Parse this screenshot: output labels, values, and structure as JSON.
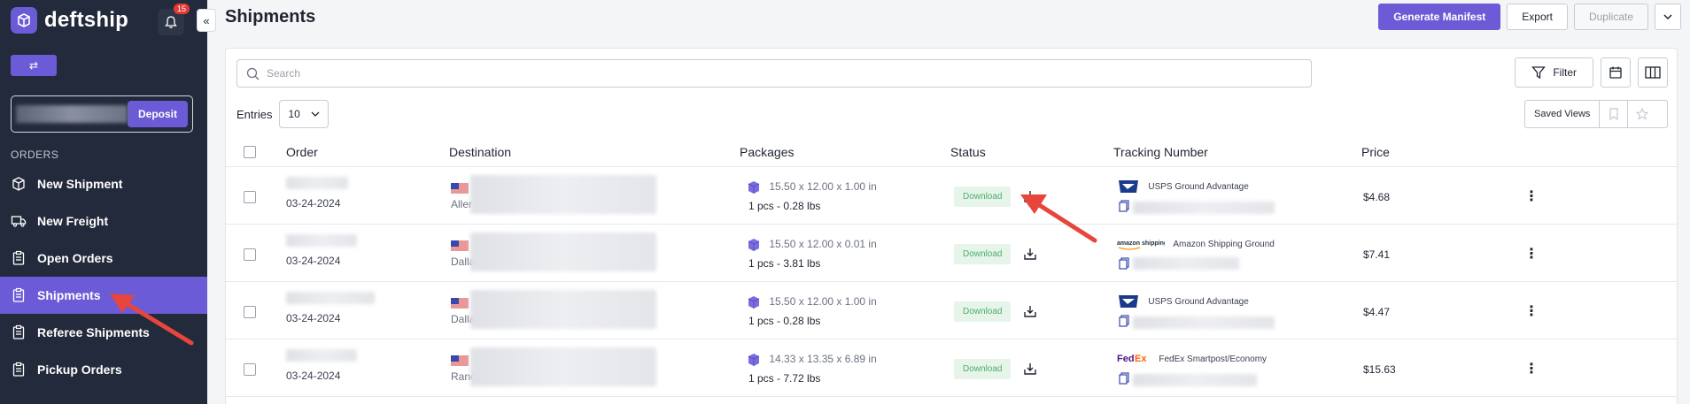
{
  "sidebar": {
    "brand": "deftship",
    "notifications_count": "15",
    "balance_button": "Deposit",
    "section_orders": "ORDERS",
    "items": [
      {
        "label": "New Shipment",
        "active": false
      },
      {
        "label": "New Freight",
        "active": false
      },
      {
        "label": "Open Orders",
        "active": false
      },
      {
        "label": "Shipments",
        "active": true
      },
      {
        "label": "Referee Shipments",
        "active": false
      },
      {
        "label": "Pickup Orders",
        "active": false
      }
    ]
  },
  "header": {
    "title": "Shipments",
    "generate_manifest": "Generate Manifest",
    "export": "Export",
    "duplicate": "Duplicate"
  },
  "toolbar": {
    "search_placeholder": "Search",
    "filter": "Filter",
    "entries_label": "Entries",
    "entries_value": "10",
    "saved_views": "Saved Views"
  },
  "table": {
    "columns": [
      "Order",
      "Destination",
      "Packages",
      "Status",
      "Tracking Number",
      "Price"
    ],
    "rows": [
      {
        "date": "03-24-2024",
        "city": "Aller",
        "dims": "15.50 x 12.00 x 1.00 in",
        "qty": "1 pcs - 0.28 lbs",
        "status": "Download",
        "carrier": "USPS Ground Advantage",
        "carrier_type": "usps",
        "price": "$4.68"
      },
      {
        "date": "03-24-2024",
        "city": "Dalla",
        "dims": "15.50 x 12.00 x 0.01 in",
        "qty": "1 pcs - 3.81 lbs",
        "status": "Download",
        "carrier": "Amazon Shipping Ground",
        "carrier_type": "amazon",
        "price": "$7.41"
      },
      {
        "date": "03-24-2024",
        "city": "Dalla",
        "dims": "15.50 x 12.00 x 1.00 in",
        "qty": "1 pcs - 0.28 lbs",
        "status": "Download",
        "carrier": "USPS Ground Advantage",
        "carrier_type": "usps",
        "price": "$4.47"
      },
      {
        "date": "03-24-2024",
        "city": "Ranc",
        "dims": "14.33 x 13.35 x 6.89 in",
        "qty": "1 pcs - 7.72 lbs",
        "status": "Download",
        "carrier": "FedEx Smartpost/Economy",
        "carrier_type": "fedex",
        "price": "$15.63"
      }
    ]
  },
  "colors": {
    "accent": "#6b5bd6",
    "sidebar_bg": "#232a3b",
    "status_green": "#4caf6a",
    "annotation_red": "#e8453c"
  }
}
